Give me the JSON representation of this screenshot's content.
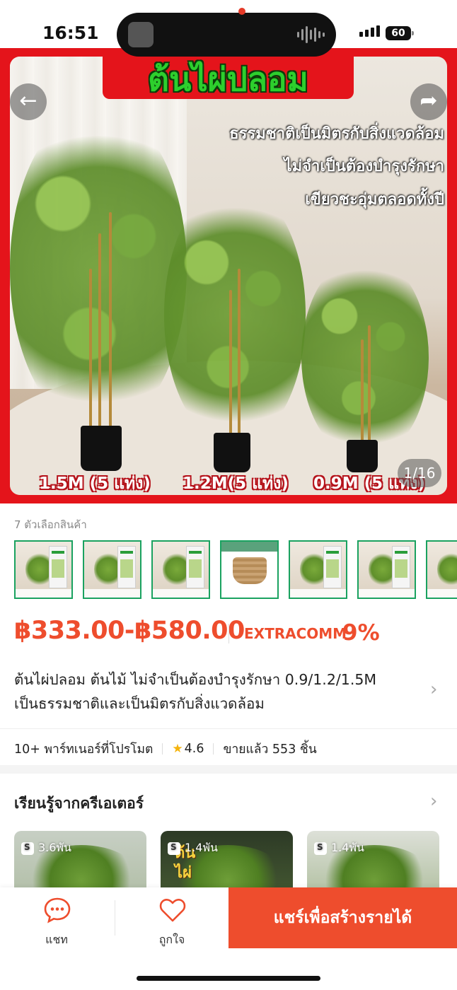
{
  "status_bar": {
    "time": "16:51",
    "battery": "60"
  },
  "hero": {
    "title": "ต้นไผ่ปลอม",
    "lines": [
      "ธรรมชาติเป็นมิตรกับสิ่งแวดล้อม",
      "ไม่จำเป็นต้องบำรุงรักษา",
      "เขียวชะอุ่มตลอดทั้งปี"
    ],
    "sizes": [
      "1.5M (5 แท่ง)",
      "1.2M(5 แท่ง)",
      "0.9M (5 แท่ง)"
    ],
    "counter": "1/16",
    "back_icon": "arrow-left-icon",
    "share_icon": "share-icon",
    "border_color": "#e4141b"
  },
  "variants": {
    "label": "7 ตัวเลือกสินค้า",
    "items": [
      {
        "type": "plant"
      },
      {
        "type": "plant"
      },
      {
        "type": "plant"
      },
      {
        "type": "basket"
      },
      {
        "type": "plant"
      },
      {
        "type": "plant"
      },
      {
        "type": "plant"
      }
    ]
  },
  "price": {
    "range": "฿333.00-฿580.00",
    "extra_comm_label": "EXTRACOMM",
    "extra_comm_value": "9%",
    "accent": "#ee4d2d"
  },
  "product": {
    "title_line1": "ต้นไผ่ปลอม ต้นไม้  ไม่จำเป็นต้องบำรุงรักษา 0.9/1.2/1.5M",
    "title_line2": "เป็นธรรมชาติและเป็นมิตรกับสิ่งแวดล้อม"
  },
  "stats": {
    "partners": "10+ พาร์ทเนอร์ที่โปรโมต",
    "rating": "4.6",
    "sold": "ขายแล้ว 553 ชิ้น"
  },
  "creators": {
    "title": "เรียนรู้จากครีเอเตอร์",
    "videos": [
      {
        "views": "3.6พัน",
        "overlay": ""
      },
      {
        "views": "1.4พัน",
        "overlay": "ต้น\nไผ่"
      },
      {
        "views": "1.4พัน",
        "overlay": ""
      }
    ]
  },
  "bottom_bar": {
    "chat_label": "แชท",
    "like_label": "ถูกใจ",
    "share_label": "แชร์เพื่อสร้างรายได้"
  }
}
